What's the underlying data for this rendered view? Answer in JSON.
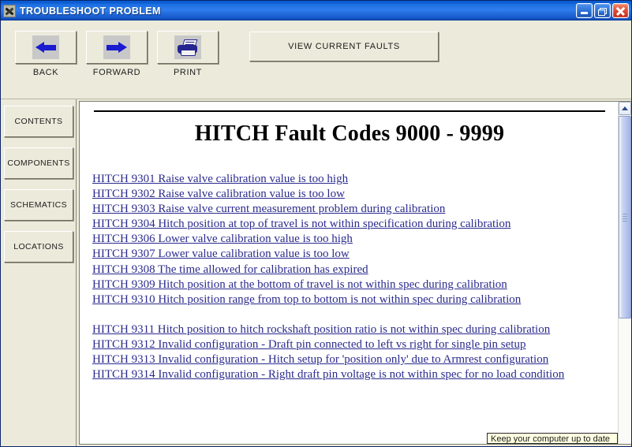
{
  "window": {
    "title": "TROUBLESHOOT PROBLEM",
    "icon": "tools-icon",
    "minimize_label": "Minimize",
    "restore_label": "Restore",
    "close_label": "Close",
    "titlebar_color": "#2f7ded",
    "chrome_color": "#eceadb"
  },
  "toolbar": {
    "buttons": [
      {
        "label": "BACK",
        "icon": "arrow-left-icon"
      },
      {
        "label": "FORWARD",
        "icon": "arrow-right-icon"
      },
      {
        "label": "PRINT",
        "icon": "printer-icon"
      }
    ],
    "view_faults_label": "VIEW CURRENT FAULTS"
  },
  "sidebar": {
    "items": [
      {
        "label": "CONTENTS"
      },
      {
        "label": "COMPONENTS"
      },
      {
        "label": "SCHEMATICS"
      },
      {
        "label": "LOCATIONS"
      }
    ]
  },
  "document": {
    "title": "HITCH Fault Codes 9000 - 9999",
    "link_color": "#2b2b8f",
    "links": [
      "HITCH 9301 Raise valve calibration value is too high",
      "HITCH 9302 Raise valve calibration value is too low",
      "HITCH 9303 Raise valve current measurement problem during calibration",
      "HITCH 9304 Hitch position at top of travel is not within specification during calibration",
      "HITCH 9306 Lower valve calibration value is too high",
      "HITCH 9307 Lower value calibration value is too low",
      "HITCH 9308 The time allowed for calibration has expired",
      "HITCH 9309 Hitch position at the bottom of travel is not within spec during calibration",
      "HITCH 9310 Hitch position range from top to bottom is not within spec during calibration",
      "HITCH 9311 Hitch position to hitch rockshaft position ratio is not within spec during calibration",
      "HITCH 9312 Invalid configuration - Draft pin connected to left vs right for single pin setup",
      "HITCH 9313 Invalid configuration - Hitch setup for 'position only' due to Armrest configuration",
      "HITCH 9314 Invalid configuration - Right draft pin voltage is not within spec for no load condition"
    ]
  },
  "scrollbar": {
    "up_arrow": "chevron-up-icon"
  },
  "balloon": {
    "text": "Keep your computer up to date"
  }
}
